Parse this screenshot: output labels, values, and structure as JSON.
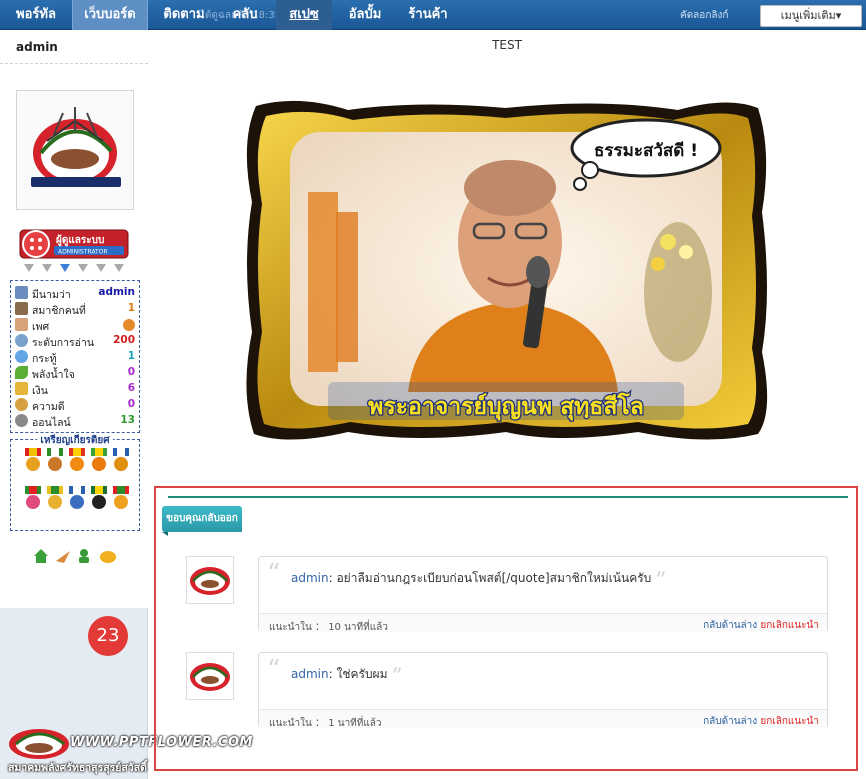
{
  "nav": {
    "items": [
      "พอร์ทัล",
      "เว็บบอร์ด",
      "ติดตาม",
      "คลับ",
      "สเปซ",
      "อัลบั้ม",
      "ร้านค้า"
    ],
    "background_text": "ได้ดูฉลแล้ว 18:35",
    "right_text": "คัดลอกลิงก์",
    "right_text2": "ไปยังหน้า",
    "menu_more": "เมนูเพิ่มเติม▾"
  },
  "sidebar": {
    "username": "admin",
    "rank_label": "ผู้ดูแลระบบ",
    "rank_sub": "ADMINISTRATOR",
    "stats": [
      {
        "label": "มีนามว่า",
        "value": "admin",
        "icon": "id-card-icon",
        "color": "#1a1aa8",
        "icon_color": "#6a8cbf"
      },
      {
        "label": "สมาชิกคนที่",
        "value": "1",
        "icon": "members-icon",
        "color": "#e07a14",
        "icon_color": "#8a6b4a"
      },
      {
        "label": "เพศ",
        "value": "",
        "icon": "gender-icon",
        "color": "#333333",
        "icon_color": "#d8a27a"
      },
      {
        "label": "ระดับการอ่าน",
        "value": "200",
        "icon": "search-icon",
        "color": "#d02020",
        "icon_color": "#7aa2cc"
      },
      {
        "label": "กระทู้",
        "value": "1",
        "icon": "chat-icon",
        "color": "#1aa2b8",
        "icon_color": "#62a6e6"
      },
      {
        "label": "พลังน้ำใจ",
        "value": "0",
        "icon": "leaf-icon",
        "color": "#a828c8",
        "icon_color": "#5aae34"
      },
      {
        "label": "เงิน",
        "value": "6",
        "icon": "money-icon",
        "color": "#a828c8",
        "icon_color": "#e6b63a"
      },
      {
        "label": "ความดี",
        "value": "0",
        "icon": "coins-icon",
        "color": "#a828c8",
        "icon_color": "#d4a040"
      },
      {
        "label": "ออนไลน์",
        "value": "13",
        "icon": "clock-icon",
        "color": "#2c9a2c",
        "icon_color": "#8a8a8a"
      }
    ],
    "medals_title": "เหรียญเกียรติยศ",
    "badge_number": "23",
    "watermark_url": "WWW.PPTFLOWER.COM",
    "watermark_sub": "สมาคมพลังศรัทธาสุรสุรย์สวัสดิ์"
  },
  "main": {
    "title": "TEST",
    "image_caption": "พระอาจารย์บุญนพ สุทฺธสีโล",
    "image_bubble": "ธรรมะสวัสดี !"
  },
  "comments": {
    "section_label": "ขอบคุณกลับออกหน้า",
    "items": [
      {
        "author": "admin",
        "text": ": อย่าลืมอ่านกฎระเบียบก่อนโพสต์[/quote]สมาชิกใหม่เน้นครับ",
        "from": "แนะนำใน",
        "time": "10 นาทีที่แล้ว",
        "reply": "กลับด้านล่าง",
        "cancel": "ยกเลิกแนะนำ"
      },
      {
        "author": "admin",
        "text": ": ใช่ครับผม",
        "from": "แนะนำใน",
        "time": "1 นาทีที่แล้ว",
        "reply": "กลับด้านล่าง",
        "cancel": "ยกเลิกแนะนำ"
      }
    ]
  }
}
